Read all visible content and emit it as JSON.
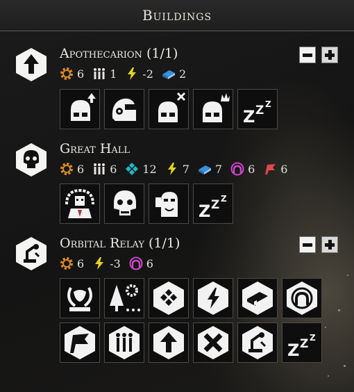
{
  "header": {
    "title": "Buildings"
  },
  "colors": {
    "gear": "#d88a2a",
    "energy": "#e4d61a",
    "book": "#3a8fd8",
    "influence": "#cc44c8",
    "loyalty": "#e04848",
    "requisition": "#24b7c8"
  },
  "buildings": [
    {
      "name": "Apothecarion (1/1)",
      "icon": "arrow-up-icon",
      "stats": [
        {
          "icon": "gear-icon",
          "value": "6"
        },
        {
          "icon": "population-icon",
          "value": "1"
        },
        {
          "icon": "energy-icon",
          "value": "-2"
        },
        {
          "icon": "research-icon",
          "value": "2"
        }
      ],
      "actions": [
        "helmet-upgrade-icon",
        "apothecary-helmet-icon",
        "helmet-cross-icon",
        "helmet-crown-icon",
        "sleep-icon"
      ]
    },
    {
      "name": "Great Hall",
      "icon": "skull-icon",
      "stats": [
        {
          "icon": "gear-icon",
          "value": "6"
        },
        {
          "icon": "population-icon",
          "value": "6"
        },
        {
          "icon": "requisition-icon",
          "value": "12"
        },
        {
          "icon": "energy-icon",
          "value": "7"
        },
        {
          "icon": "research-icon",
          "value": "7"
        },
        {
          "icon": "influence-icon",
          "value": "6"
        },
        {
          "icon": "loyalty-icon",
          "value": "6"
        }
      ],
      "actions": [
        "chaplain-icon",
        "servitor-skull-icon",
        "techmarine-icon",
        "sleep-icon"
      ]
    },
    {
      "name": "Orbital Relay (1/1)",
      "icon": "relay-icon",
      "stats": [
        {
          "icon": "gear-icon",
          "value": "6"
        },
        {
          "icon": "energy-icon",
          "value": "-3"
        },
        {
          "icon": "influence-icon",
          "value": "6"
        }
      ],
      "actions": [
        "laurel-icon",
        "forest-gear-icon",
        "hex-diamond-icon",
        "hex-energy-icon",
        "hex-book-icon",
        "hex-signal-icon",
        "hex-flag-icon",
        "hex-population-icon",
        "hex-arrow-icon",
        "hex-cross-icon",
        "hex-relay-icon",
        "sleep-icon"
      ]
    }
  ]
}
